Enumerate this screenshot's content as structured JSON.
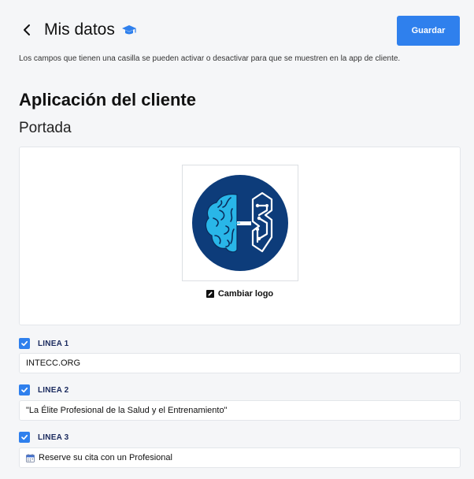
{
  "header": {
    "title": "Mis datos",
    "save_label": "Guardar",
    "back_icon": "chevron-left-icon",
    "title_icon": "graduation-cap-icon"
  },
  "description": "Los campos que tienen una casilla se pueden activar o desactivar para que se muestren en la app de cliente.",
  "section_title": "Aplicación del cliente",
  "subsection_title": "Portada",
  "logo_card": {
    "logo_icon": "brain-circuit-logo",
    "change_logo_label": "Cambiar logo",
    "change_logo_icon": "edit-icon"
  },
  "lines": [
    {
      "label": "LINEA 1",
      "checked": true,
      "value": "INTECC.ORG"
    },
    {
      "label": "LINEA 2",
      "checked": true,
      "value": "\"La Élite Profesional de la Salud y el Entrenamiento\""
    },
    {
      "label": "LINEA 3",
      "checked": true,
      "value": "Reserve su cita con un Profesional",
      "value_icon": "calendar-icon"
    }
  ],
  "colors": {
    "accent": "#2f80ed",
    "logo_navy": "#0d3c7a",
    "logo_brain": "#29b6e8",
    "label_navy": "#1a2a5e",
    "background": "#f5f6f8"
  }
}
